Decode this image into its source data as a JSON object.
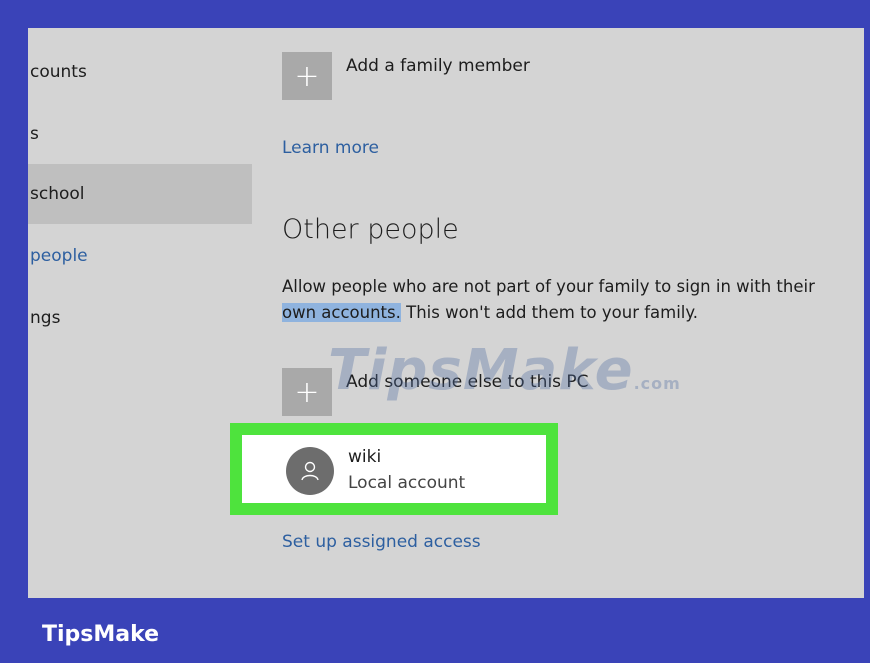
{
  "sidebar": {
    "items": [
      {
        "label": "counts"
      },
      {
        "label": "s"
      },
      {
        "label": "school"
      },
      {
        "label": "people"
      },
      {
        "label": "ngs"
      }
    ]
  },
  "family": {
    "add_label": "Add a family member",
    "learn_more": "Learn more"
  },
  "other_people": {
    "heading": "Other people",
    "desc_highlight": "own accounts.",
    "desc_part1": "Allow people who are not part of your family to sign in with their",
    "desc_part2": " This won't add them to your family.",
    "add_label": "Add someone else to this PC",
    "account": {
      "name": "wiki",
      "type": "Local account"
    },
    "assigned_access": "Set up assigned access"
  },
  "plus_glyph": "+",
  "watermark": {
    "text": "TipsMake",
    "suffix": ".com"
  },
  "brand": {
    "text": "TipsMake"
  },
  "colors": {
    "frame": "#3a43b8",
    "highlight_border": "#4ee33d",
    "link": "#2d5fa0"
  }
}
